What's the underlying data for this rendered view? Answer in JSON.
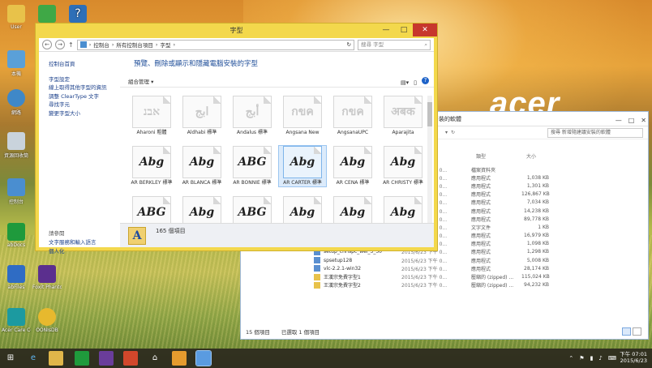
{
  "desktop": {
    "brand": "acer",
    "icons": [
      {
        "label": "User"
      },
      {
        "label": "本機"
      },
      {
        "label": "網路"
      },
      {
        "label": "資源回收筒"
      },
      {
        "label": "控制台"
      },
      {
        "label": "abDocs"
      },
      {
        "label": "abFiles"
      },
      {
        "label": "Foxit PhantomPDF"
      },
      {
        "label": "Acer Care Center"
      },
      {
        "label": "OONIsDB"
      }
    ]
  },
  "window": {
    "title": "字型",
    "breadcrumb": [
      "控制台",
      "所有控制台項目",
      "字型"
    ],
    "search_placeholder": "搜尋 字型",
    "left_links": [
      "控制台首頁",
      "字型設定",
      "線上取得其他字型的資訊",
      "調整 ClearType 文字",
      "尋找字元",
      "變更字型大小"
    ],
    "see_also": "請參閱",
    "bottom_links": [
      "文字服務和輸入語言",
      "個人化"
    ],
    "heading": "預覽、刪除或顯示和隱藏電腦安裝的字型",
    "organize": "組合管理",
    "fonts": [
      {
        "name": "Aharoni 粗體",
        "sample": "אבנ",
        "faded": true
      },
      {
        "name": "Aldhabi 標準",
        "sample": "ابج",
        "faded": true
      },
      {
        "name": "Andalus 標準",
        "sample": "أبج",
        "faded": true
      },
      {
        "name": "Angsana New",
        "sample": "กขค",
        "faded": true
      },
      {
        "name": "AngsanaUPC",
        "sample": "กขค",
        "faded": true
      },
      {
        "name": "Aparajita",
        "sample": "अबक",
        "faded": true
      },
      {
        "name": "AR BERKLEY 標準",
        "sample": "Abg",
        "faded": false
      },
      {
        "name": "AR BLANCA 標準",
        "sample": "Abg",
        "faded": false
      },
      {
        "name": "AR BONNIE 標準",
        "sample": "ABG",
        "faded": false
      },
      {
        "name": "AR CARTER 標準",
        "sample": "Abg",
        "faded": false,
        "selected": true
      },
      {
        "name": "AR CENA 標準",
        "sample": "Abg",
        "faded": false
      },
      {
        "name": "AR CHRISTY 標準",
        "sample": "Abg",
        "faded": false
      },
      {
        "name": "",
        "sample": "ABG",
        "faded": false
      },
      {
        "name": "",
        "sample": "Abg",
        "faded": false
      },
      {
        "name": "",
        "sample": "ABG",
        "faded": false
      },
      {
        "name": "",
        "sample": "Abg",
        "faded": false
      },
      {
        "name": "",
        "sample": "Abg",
        "faded": false
      },
      {
        "name": "",
        "sample": "Abg",
        "faded": false
      }
    ],
    "status": "165 個項目"
  },
  "window2": {
    "title": "裝的軟體",
    "search": "搜尋 新增隨建議安裝的軟體",
    "headers": {
      "type": "類型",
      "size": "大小"
    },
    "rows": [
      {
        "name": "",
        "date": "2015/6/23 下午 0...",
        "type": "檔案資料夾",
        "size": ""
      },
      {
        "name": "",
        "date": "2015/6/23 下午 0...",
        "type": "應用程式",
        "size": "1,038 KB"
      },
      {
        "name": "",
        "date": "2015/6/23 下午 0...",
        "type": "應用程式",
        "size": "1,301 KB"
      },
      {
        "name": "",
        "date": "2015/6/23 下午 0...",
        "type": "應用程式",
        "size": "126,867 KB"
      },
      {
        "name": "",
        "date": "2015/6/23 下午 0...",
        "type": "應用程式",
        "size": "7,034 KB"
      },
      {
        "name": "",
        "date": "2015/6/23 下午 0...",
        "type": "應用程式",
        "size": "14,238 KB"
      },
      {
        "name": "",
        "date": "2015/6/23 下午 0...",
        "type": "應用程式",
        "size": "89,778 KB"
      },
      {
        "name": "",
        "date": "2015/6/23 下午 0...",
        "type": "文字文件",
        "size": "1 KB"
      },
      {
        "name": "",
        "date": "2015/6/23 下午 0...",
        "type": "應用程式",
        "size": "16,979 KB"
      },
      {
        "name": "",
        "date": "2015/6/23 下午 0...",
        "type": "應用程式",
        "size": "1,098 KB"
      },
      {
        "name": "setup_chrispc_wei_3_30",
        "date": "2015/6/23 下午 0...",
        "type": "應用程式",
        "size": "1,298 KB"
      },
      {
        "name": "spsetup128",
        "date": "2015/6/23 下午 0...",
        "type": "應用程式",
        "size": "5,008 KB"
      },
      {
        "name": "vlc-2.2.1-win32",
        "date": "2015/6/23 下午 0...",
        "type": "應用程式",
        "size": "28,174 KB"
      },
      {
        "name": "王漢宗免費字型1",
        "date": "2015/6/23 下午 0...",
        "type": "壓縮的 (zipped) ...",
        "size": "115,024 KB"
      },
      {
        "name": "王漢宗免費字型2",
        "date": "2015/6/23 下午 0...",
        "type": "壓縮的 (zipped) ...",
        "size": "94,232 KB"
      }
    ],
    "count": "15 個項目",
    "selected": "已選取 1 個項目"
  },
  "taskbar": {
    "time": "下午 07:01",
    "date": "2015/6/23"
  }
}
